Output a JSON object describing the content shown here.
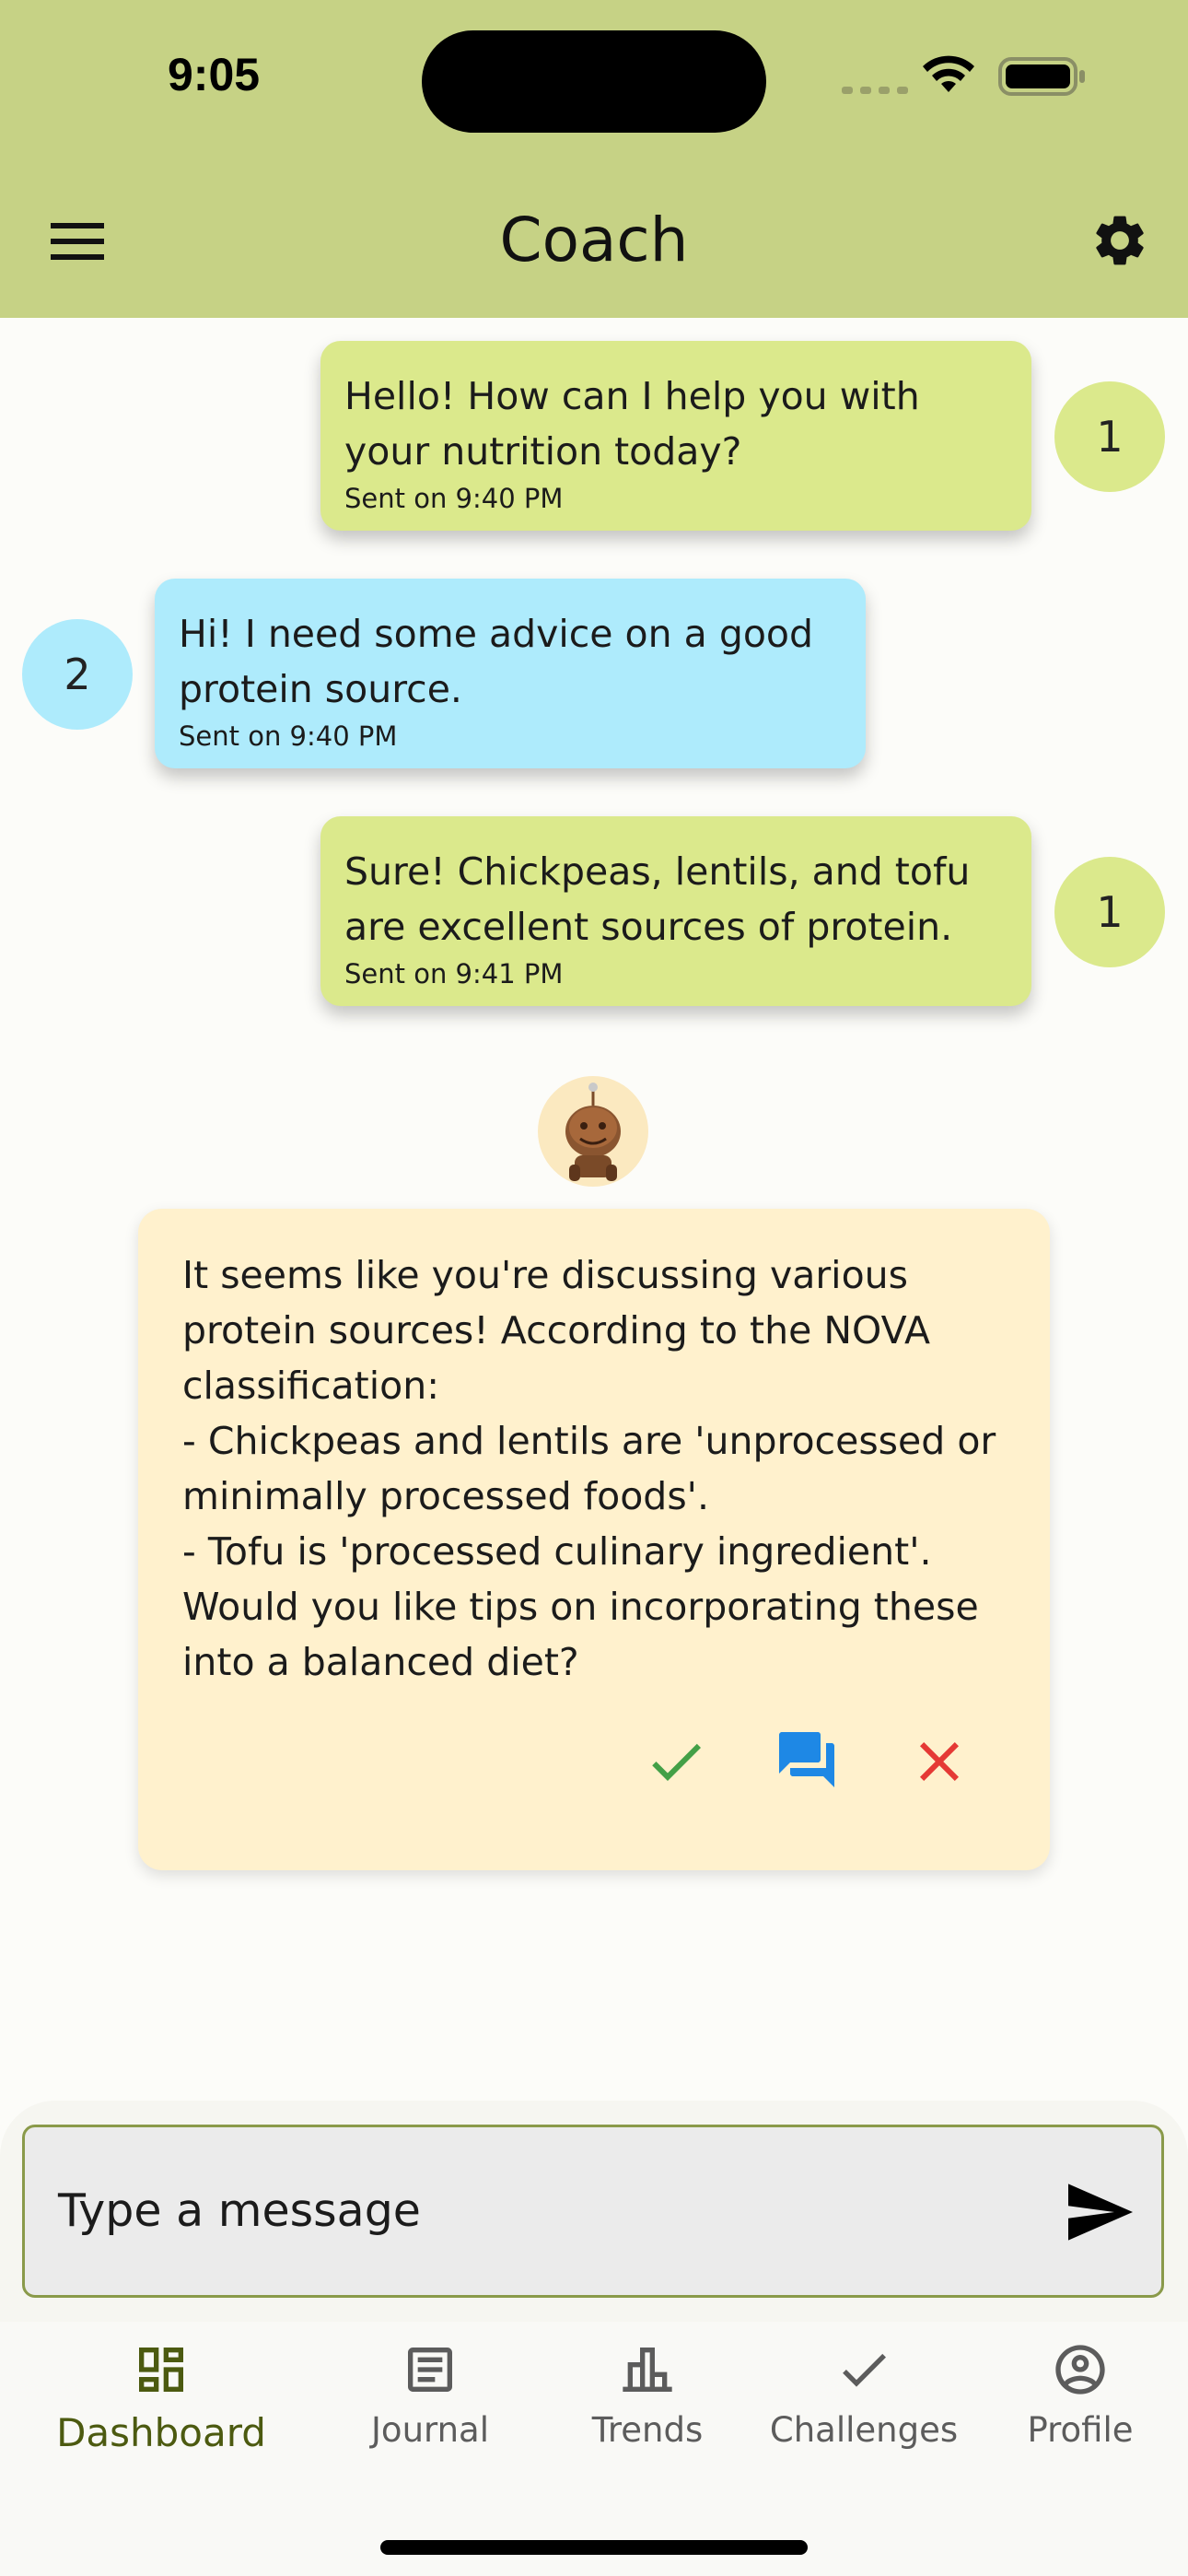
{
  "status_bar": {
    "time": "9:05"
  },
  "header": {
    "title": "Coach"
  },
  "messages": [
    {
      "sender": "1",
      "text": "Hello! How can I help you with your nutrition today?",
      "meta": "Sent on 9:40 PM"
    },
    {
      "sender": "2",
      "text": "Hi! I need some advice on a good protein source.",
      "meta": "Sent on 9:40 PM"
    },
    {
      "sender": "1",
      "text": "Sure! Chickpeas, lentils, and tofu are excellent sources of protein.",
      "meta": "Sent on 9:41 PM"
    }
  ],
  "coach_card": {
    "text": "It seems like you're discussing various protein sources! According to the NOVA classification:\n- Chickpeas and lentils are 'unprocessed or minimally processed foods'.\n- Tofu is 'processed culinary ingredient'.\nWould you like tips on incorporating these into a balanced diet?"
  },
  "composer": {
    "placeholder": "Type a message"
  },
  "nav": [
    {
      "label": "Dashboard",
      "icon": "dashboard-icon",
      "active": true
    },
    {
      "label": "Journal",
      "icon": "journal-icon",
      "active": false
    },
    {
      "label": "Trends",
      "icon": "trends-icon",
      "active": false
    },
    {
      "label": "Challenges",
      "icon": "check-icon",
      "active": false
    },
    {
      "label": "Profile",
      "icon": "profile-icon",
      "active": false
    }
  ],
  "colors": {
    "header_bg": "#c6d285",
    "user_bubble": "#dbe98c",
    "other_bubble": "#aeebfc",
    "coach_card": "#fff1cd",
    "accent": "#4c5a10"
  }
}
